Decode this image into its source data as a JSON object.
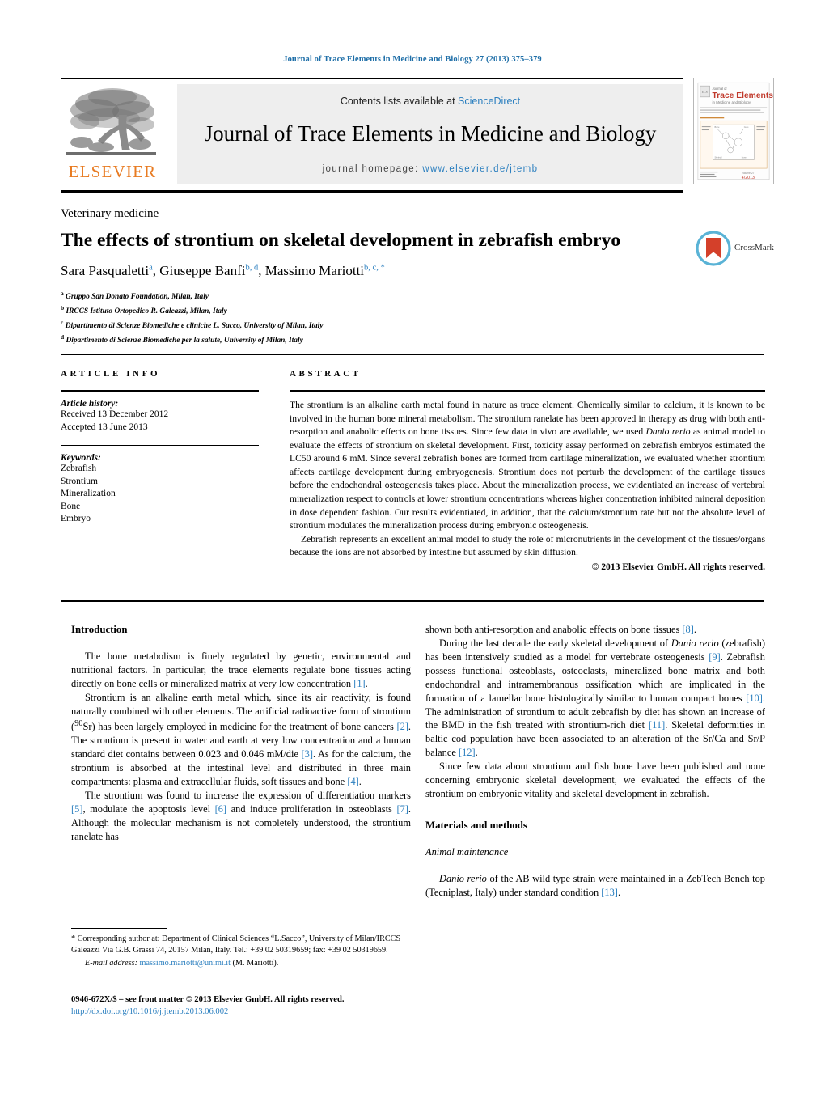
{
  "running_head": "Journal of Trace Elements in Medicine and Biology 27 (2013) 375–379",
  "masthead": {
    "contents_prefix": "Contents lists available at ",
    "sciencedirect": "ScienceDirect",
    "journal_title": "Journal of Trace Elements in Medicine and Biology",
    "homepage_label": "journal homepage: ",
    "homepage_url": "www.elsevier.de/jtemb",
    "publisher": "ELSEVIER",
    "cover": {
      "journal_of": "Journal of",
      "title_line": "Trace Elements",
      "subtitle_line": "in Medicine and Biology",
      "footer_left": "Elsevier",
      "footer_right": "Volume 27"
    }
  },
  "accent_colors": {
    "link_blue": "#2b7fbf",
    "elsevier_orange": "#e87b22",
    "crossmark_red": "#d4402a",
    "crossmark_blue": "#5ab3d6",
    "banner_grey": "#eeeeee"
  },
  "article": {
    "section_label": "Veterinary medicine",
    "title": "The effects of strontium on skeletal development in zebrafish embryo",
    "crossmark_label": "CrossMark",
    "authors": [
      {
        "name": "Sara Pasqualetti",
        "marks": "a"
      },
      {
        "name": "Giuseppe Banfi",
        "marks": "b, d"
      },
      {
        "name": "Massimo Mariotti",
        "marks": "b, c, *"
      }
    ],
    "affiliations": [
      {
        "mark": "a",
        "text": "Gruppo San Donato Foundation, Milan, Italy"
      },
      {
        "mark": "b",
        "text": "IRCCS Istituto Ortopedico R. Galeazzi, Milan, Italy"
      },
      {
        "mark": "c",
        "text": "Dipartimento di Scienze Biomediche e cliniche L. Sacco, University of Milan, Italy"
      },
      {
        "mark": "d",
        "text": "Dipartimento di Scienze Biomediche per la salute, University of Milan, Italy"
      }
    ]
  },
  "article_info": {
    "heading": "ARTICLE INFO",
    "history_label": "Article history:",
    "received": "Received 13 December 2012",
    "accepted": "Accepted 13 June 2013",
    "keywords_label": "Keywords:",
    "keywords": [
      "Zebrafish",
      "Strontium",
      "Mineralization",
      "Bone",
      "Embryo"
    ]
  },
  "abstract": {
    "heading": "ABSTRACT",
    "paragraph_1_a": "The strontium is an alkaline earth metal found in nature as trace element. Chemically similar to calcium, it is known to be involved in the human bone mineral metabolism. The strontium ranelate has been approved in therapy as drug with both anti-resorption and anabolic effects on bone tissues. Since few data in vivo are available, we used ",
    "paragraph_1_italic": "Danio rerio",
    "paragraph_1_b": " as animal model to evaluate the effects of strontium on skeletal development. First, toxicity assay performed on zebrafish embryos estimated the LC50 around 6 mM. Since several zebrafish bones are formed from cartilage mineralization, we evaluated whether strontium affects cartilage development during embryogenesis. Strontium does not perturb the development of the cartilage tissues before the endochondral osteogenesis takes place. About the mineralization process, we evidentiated an increase of vertebral mineralization respect to controls at lower strontium concentrations whereas higher concentration inhibited mineral deposition in dose dependent fashion. Our results evidentiated, in addition, that the calcium/strontium rate but not the absolute level of strontium modulates the mineralization process during embryonic osteogenesis.",
    "paragraph_2": "Zebrafish represents an excellent animal model to study the role of micronutrients in the development of the tissues/organs because the ions are not absorbed by intestine but assumed by skin diffusion.",
    "copyright": "© 2013 Elsevier GmbH. All rights reserved."
  },
  "body": {
    "left": {
      "introduction_heading": "Introduction",
      "p1_a": "The bone metabolism is finely regulated by genetic, environmental and nutritional factors. In particular, the trace elements regulate bone tissues acting directly on bone cells or mineralized matrix at very low concentration ",
      "p1_ref": "[1]",
      "p1_b": ".",
      "p2_a": "Strontium is an alkaline earth metal which, since its air reactivity, is found naturally combined with other elements. The artificial radioactive form of strontium (",
      "p2_sup": "90",
      "p2_b": "Sr) has been largely employed in medicine for the treatment of bone cancers ",
      "p2_ref1": "[2]",
      "p2_c": ". The strontium is present in water and earth at very low concentration and a human standard diet contains between 0.023 and 0.046 mM/die ",
      "p2_ref2": "[3]",
      "p2_d": ". As for the calcium, the strontium is absorbed at the intestinal level and distributed in three main compartments: plasma and extracellular fluids, soft tissues and bone ",
      "p2_ref3": "[4]",
      "p2_e": ".",
      "p3_a": "The strontium was found to increase the expression of differentiation markers ",
      "p3_ref1": "[5]",
      "p3_b": ", modulate the apoptosis level ",
      "p3_ref2": "[6]",
      "p3_c": " and induce proliferation in osteoblasts ",
      "p3_ref3": "[7]",
      "p3_d": ". Although the molecular mechanism is not completely understood, the strontium ranelate has"
    },
    "right": {
      "p1_a": "shown both anti-resorption and anabolic effects on bone tissues ",
      "p1_ref": "[8]",
      "p1_b": ".",
      "p2_a": "During the last decade the early skeletal development of ",
      "p2_italic1": "Danio rerio",
      "p2_b": " (zebrafish) has been intensively studied as a model for vertebrate osteogenesis ",
      "p2_ref1": "[9]",
      "p2_c": ". Zebrafish possess functional osteoblasts, osteoclasts, mineralized bone matrix and both endochondral and intramembranous ossification which are implicated in the formation of a lamellar bone histologically similar to human compact bones ",
      "p2_ref2": "[10]",
      "p2_d": ". The administration of strontium to adult zebrafish by diet has shown an increase of the BMD in the fish treated with strontium-rich diet ",
      "p2_ref3": "[11]",
      "p2_e": ". Skeletal deformities in baltic cod population have been associated to an alteration of the Sr/Ca and Sr/P balance ",
      "p2_ref4": "[12]",
      "p2_f": ".",
      "p3": "Since few data about strontium and fish bone have been published and none concerning embryonic skeletal development, we evaluated the effects of the strontium on embryonic vitality and skeletal development in zebrafish.",
      "materials_heading": "Materials and methods",
      "animal_heading": "Animal maintenance",
      "p4_italic": "Danio rerio",
      "p4_a": " of the AB wild type strain were maintained in a ZebTech Bench top (Tecniplast, Italy) under standard condition ",
      "p4_ref": "[13]",
      "p4_b": "."
    }
  },
  "footnotes": {
    "corresponding": "* Corresponding author at: Department of Clinical Sciences “L.Sacco”, University of Milan/IRCCS Galeazzi Via G.B. Grassi 74, 20157 Milan, Italy. Tel.: +39 02 50319659; fax: +39 02 50319659.",
    "email_label": "E-mail address:",
    "email": "massimo.mariotti@unimi.it",
    "email_suffix": " (M. Mariotti).",
    "issn_line": "0946-672X/$ – see front matter © 2013 Elsevier GmbH. All rights reserved.",
    "doi": "http://dx.doi.org/10.1016/j.jtemb.2013.06.002"
  }
}
